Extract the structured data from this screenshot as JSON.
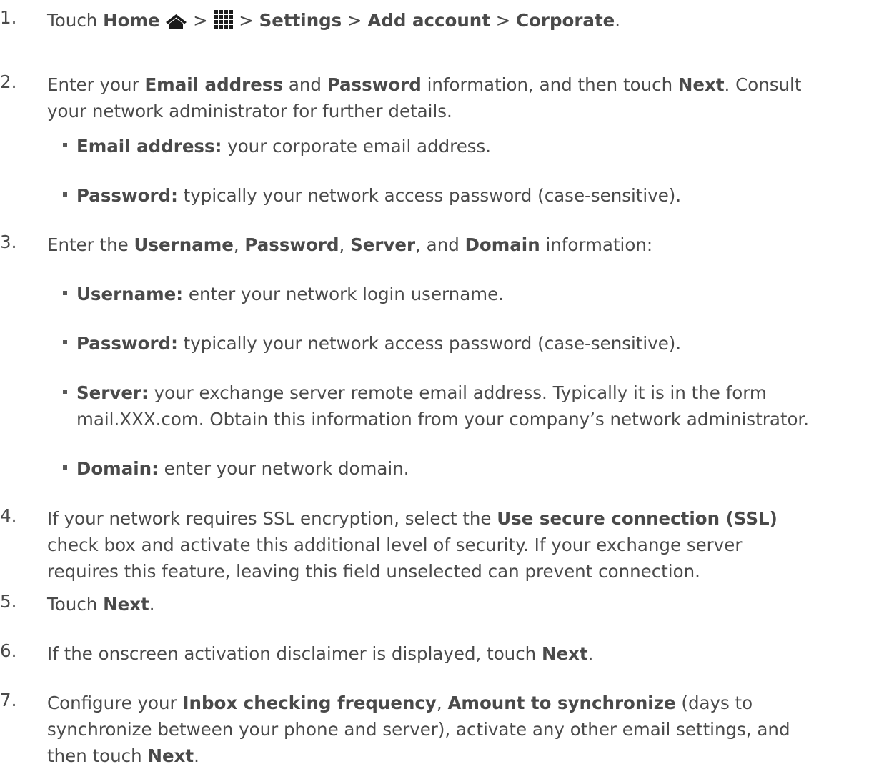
{
  "steps": [
    {
      "num": "1.",
      "segments": [
        {
          "t": "Touch "
        },
        {
          "b": "Home"
        },
        {
          "t": " "
        },
        {
          "icon": "home-icon"
        },
        {
          "t": " > "
        },
        {
          "icon": "apps-grid-icon"
        },
        {
          "t": " > "
        },
        {
          "b": "Settings"
        },
        {
          "t": " > "
        },
        {
          "b": "Add account"
        },
        {
          "t": " > "
        },
        {
          "b": "Corporate"
        },
        {
          "t": "."
        }
      ]
    },
    {
      "num": "2.",
      "segments": [
        {
          "t": "Enter your "
        },
        {
          "b": "Email address"
        },
        {
          "t": " and "
        },
        {
          "b": "Password"
        },
        {
          "t": " information, and then touch "
        },
        {
          "b": "Next"
        },
        {
          "t": ". Consult"
        },
        {
          "br": true
        },
        {
          "t": "your network administrator for further details."
        }
      ],
      "bullets": [
        {
          "label": "Email address:",
          "text": " your corporate email address."
        },
        {
          "label": "Password:",
          "text": " typically your network access password (case-sensitive)."
        }
      ]
    },
    {
      "num": "3.",
      "segments": [
        {
          "t": "Enter the "
        },
        {
          "b": "Username"
        },
        {
          "t": ", "
        },
        {
          "b": "Password"
        },
        {
          "t": ", "
        },
        {
          "b": "Server"
        },
        {
          "t": ", and "
        },
        {
          "b": "Domain"
        },
        {
          "t": " information:"
        }
      ],
      "bullets": [
        {
          "label": "Username:",
          "text": " enter your network login username."
        },
        {
          "label": "Password:",
          "text": " typically your network access password (case-sensitive)."
        },
        {
          "label": "Server:",
          "text": " your exchange server remote email address. Typically it is in the form",
          "line2": "mail.XXX.com. Obtain this information from your company’s network administrator."
        },
        {
          "label": "Domain:",
          "text": " enter your network domain."
        }
      ]
    },
    {
      "num": "4.",
      "segments": [
        {
          "t": "If your network requires SSL encryption, select the "
        },
        {
          "b": "Use secure connection (SSL)"
        },
        {
          "br": true
        },
        {
          "t": "check box and activate this additional level of security. If your exchange server"
        },
        {
          "br": true
        },
        {
          "t": "requires this feature, leaving this field unselected can prevent connection."
        }
      ]
    },
    {
      "num": "5.",
      "segments": [
        {
          "t": "Touch "
        },
        {
          "b": "Next"
        },
        {
          "t": "."
        }
      ]
    },
    {
      "num": "6.",
      "segments": [
        {
          "t": "If the onscreen activation disclaimer is displayed, touch "
        },
        {
          "b": "Next"
        },
        {
          "t": "."
        }
      ]
    },
    {
      "num": "7.",
      "segments": [
        {
          "t": "Configure your "
        },
        {
          "b": "Inbox checking frequency"
        },
        {
          "t": ", "
        },
        {
          "b": "Amount to synchronize"
        },
        {
          "t": " (days to"
        },
        {
          "br": true
        },
        {
          "t": "synchronize between your phone and server), activate any other email settings, and"
        },
        {
          "br": true
        },
        {
          "t": "then touch "
        },
        {
          "b": "Next"
        },
        {
          "t": "."
        }
      ]
    }
  ]
}
